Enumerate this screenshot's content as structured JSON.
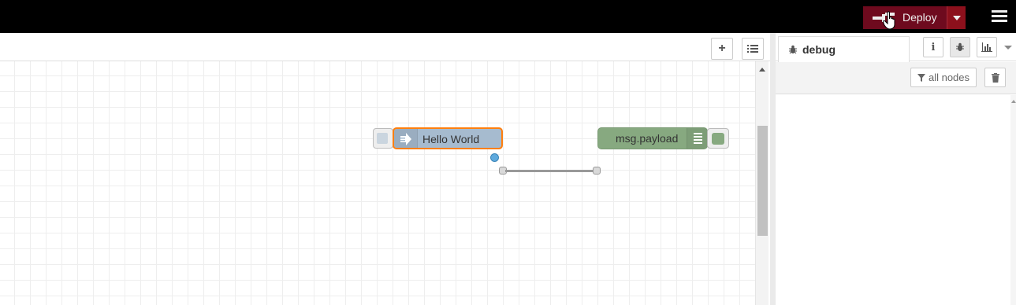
{
  "header": {
    "deploy_label": "Deploy"
  },
  "workspace": {
    "toolbar": {
      "add_icon": "plus-icon",
      "list_icon": "list-icon"
    },
    "nodes": {
      "inject": {
        "label": "Hello World",
        "color": "#a6bbcf",
        "selected_border": "#ff7f0e"
      },
      "debug": {
        "label": "msg.payload",
        "color": "#87a980"
      }
    }
  },
  "sidebar": {
    "active_tab": "debug",
    "filter_label": "all nodes",
    "icons": [
      "info-icon",
      "bug-icon",
      "chart-icon"
    ]
  },
  "colors": {
    "header_bg": "#000000",
    "deploy_bg": "#8c101c"
  }
}
